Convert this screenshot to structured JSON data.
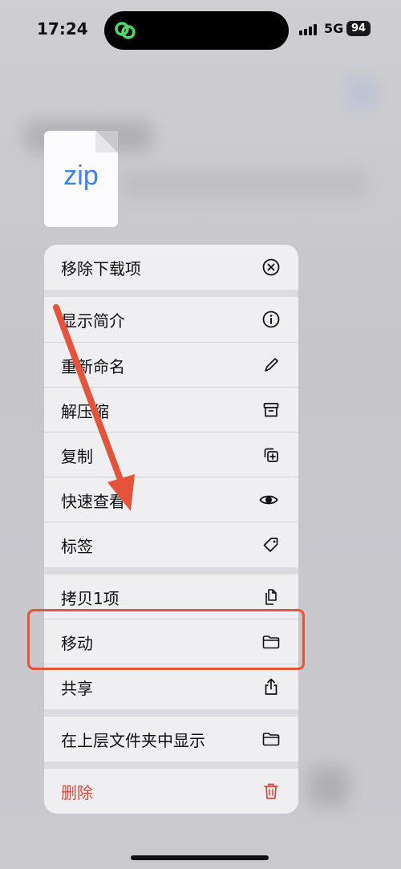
{
  "status_bar": {
    "time": "17:24",
    "network": "5G",
    "battery": "94"
  },
  "file": {
    "extension": "zip"
  },
  "menu": {
    "items": [
      {
        "label": "移除下载项",
        "icon": "x-circle-icon"
      },
      {
        "label": "显示简介",
        "icon": "info-icon"
      },
      {
        "label": "重新命名",
        "icon": "pencil-icon"
      },
      {
        "label": "解压缩",
        "icon": "archive-icon"
      },
      {
        "label": "复制",
        "icon": "duplicate-icon"
      },
      {
        "label": "快速查看",
        "icon": "eye-icon"
      },
      {
        "label": "标签",
        "icon": "tag-icon"
      },
      {
        "label": "拷贝1项",
        "icon": "copy-doc-icon"
      },
      {
        "label": "移动",
        "icon": "folder-icon"
      },
      {
        "label": "共享",
        "icon": "share-icon"
      },
      {
        "label": "在上层文件夹中显示",
        "icon": "folder-icon"
      },
      {
        "label": "删除",
        "icon": "trash-icon"
      }
    ]
  },
  "colors": {
    "destructive": "#e5443a",
    "annotation": "#e5533a",
    "file_extension": "#3b82f6"
  }
}
